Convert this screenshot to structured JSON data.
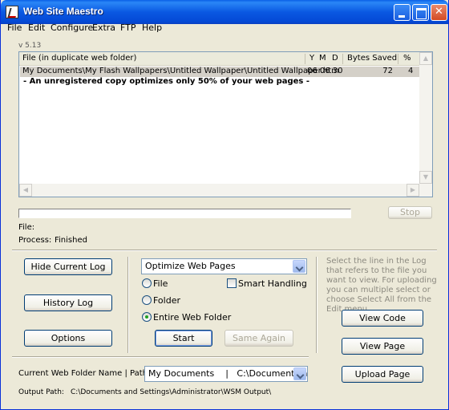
{
  "window": {
    "title": "Web Site Maestro"
  },
  "menu": {
    "file": "File",
    "edit": "Edit",
    "configure": "Configure",
    "extra": "Extra",
    "ftp": "FTP",
    "help": "Help"
  },
  "version": "v 5.13",
  "log": {
    "headers": {
      "file": "File (in duplicate web folder)",
      "y": "Y",
      "m": "M",
      "d": "D",
      "bytes": "Bytes Saved",
      "pct": "%"
    },
    "rows": [
      {
        "file": "My Documents\\My Flash Wallpapers\\Untitled Wallpaper\\Untitled Wallpaper.htm",
        "ymd": "06 06 30",
        "bytes": "72",
        "pct": "4"
      }
    ],
    "notice": "- An unregistered copy optimizes only 50% of your web pages -"
  },
  "progress": {
    "value_percent": 0,
    "stop_label": "Stop"
  },
  "status": {
    "file_label": "File:",
    "process_label": "Process:",
    "process_value": "Finished"
  },
  "left_buttons": {
    "hide_log": "Hide Current Log",
    "history_log": "History Log",
    "options": "Options"
  },
  "action": {
    "mode_selected": "Optimize Web Pages",
    "scope_file": "File",
    "scope_folder": "Folder",
    "scope_entire": "Entire Web Folder",
    "selected_scope": "Entire Web Folder",
    "smart_handling": "Smart Handling",
    "smart_checked": false,
    "start": "Start",
    "same_again": "Same Again"
  },
  "help_text": "Select the line in the Log that refers to the file you want to view. For uploading you can multiple select or choose Select All from the Edit menu.",
  "right_buttons": {
    "view_code": "View Code",
    "view_page": "View Page",
    "upload_page": "Upload Page"
  },
  "web_folder": {
    "label": "Current Web Folder Name | Path:",
    "value": "My Documents    |   C:\\Documents ar"
  },
  "output": {
    "label": "Output Path:",
    "value": "C:\\Documents and Settings\\Administrator\\WSM Output\\"
  }
}
